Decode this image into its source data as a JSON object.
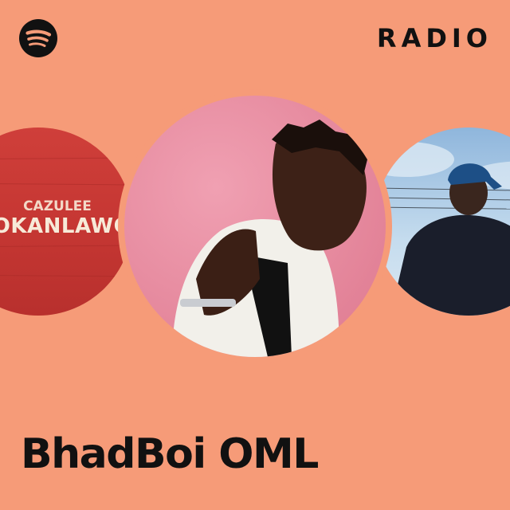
{
  "brand": {
    "logo_icon": "spotify-logo-icon",
    "color": "#111111"
  },
  "header": {
    "label": "RADIO"
  },
  "background_color": "#f69b78",
  "artwork": [
    {
      "name": "album-art-left",
      "text_top": "CAZULEE",
      "text_main": "OKANLAWO",
      "dominant_color": "#c93a36"
    },
    {
      "name": "album-art-center",
      "dominant_color": "#e98ba0"
    },
    {
      "name": "album-art-right",
      "dominant_color": "#a9c9e6"
    }
  ],
  "station": {
    "title": "BhadBoi OML"
  }
}
